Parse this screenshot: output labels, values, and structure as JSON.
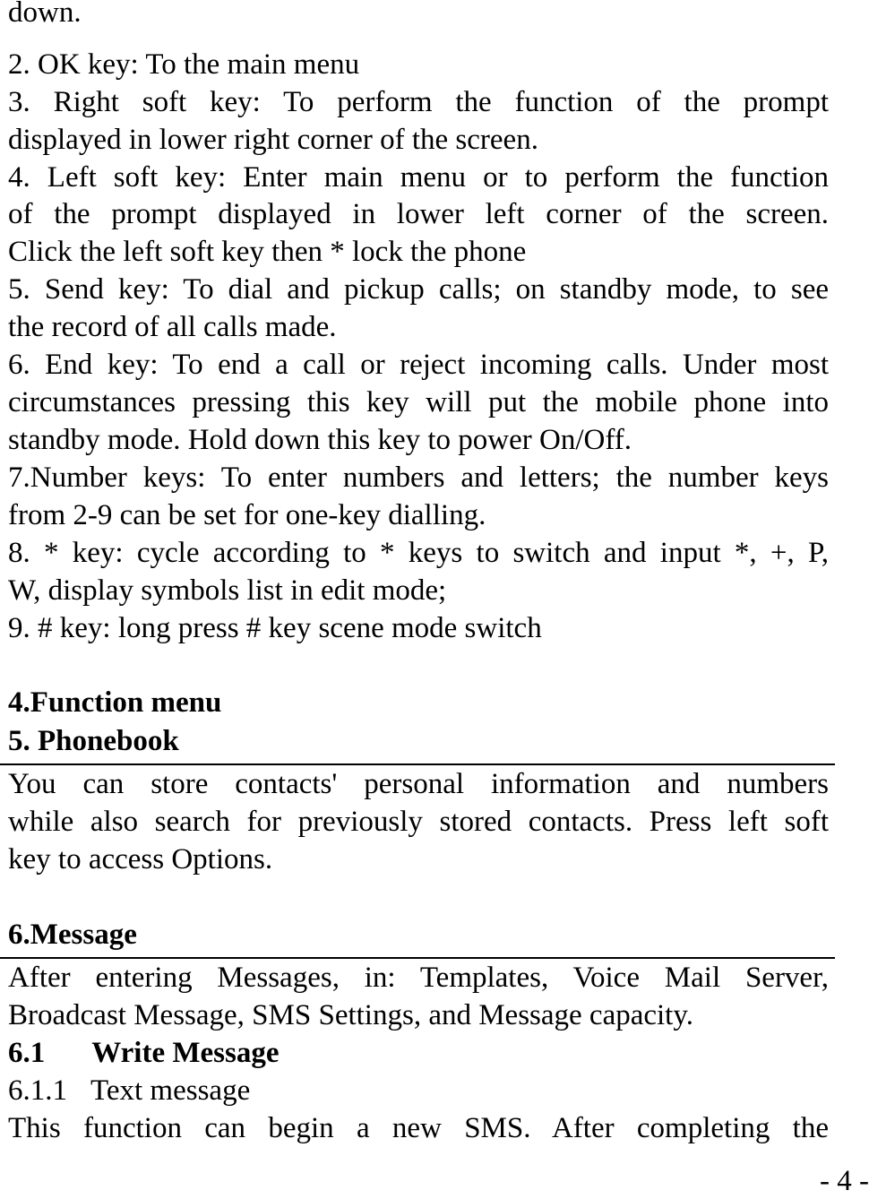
{
  "document": {
    "lines": [
      "down.",
      "2. OK key: To the main menu",
      "3.  Right  soft  key:  To  perform  the  function  of  the  prompt",
      "displayed in lower right corner of the screen.",
      "4. Left soft key: Enter main menu or to perform the function",
      "of  the  prompt  displayed  in  lower  left  corner  of  the  screen.",
      "Click the left soft key then * lock the phone",
      "5. Send key: To dial and pickup calls; on standby mode, to see",
      "the record of all calls made.",
      "6. End key: To end a call or reject incoming calls. Under most",
      "circumstances pressing this key will put the mobile phone into",
      "standby mode. Hold down this key to power On/Off.",
      "7.Number keys: To enter numbers and letters; the number keys",
      "from 2-9 can be set for one-key dialling.",
      "8. * key: cycle according to * keys to switch and input *, +, P,",
      "W, display symbols list in edit mode;",
      "9. # key: long press # key scene mode switch"
    ],
    "heading_function_menu": "4.Function menu",
    "heading_phonebook": "5. Phonebook",
    "phonebook_lines": [
      "You  can  store  contacts'  personal  information  and  numbers",
      "while also search for previously stored contacts. Press left soft",
      "key to access Options."
    ],
    "heading_message": "6.Message",
    "message_lines": [
      "After  entering  Messages,  in:  Templates,  Voice  Mail  Server,",
      "Broadcast Message, SMS Settings, and Message capacity."
    ],
    "subheading_write_message": {
      "number": "6.1",
      "title": "Write Message"
    },
    "subsubheading_text_message": {
      "number": "6.1.1",
      "title": "Text message"
    },
    "last_line": "This  function  can  begin  a  new  SMS.  After  completing  the",
    "page_number": "- 4 -"
  }
}
